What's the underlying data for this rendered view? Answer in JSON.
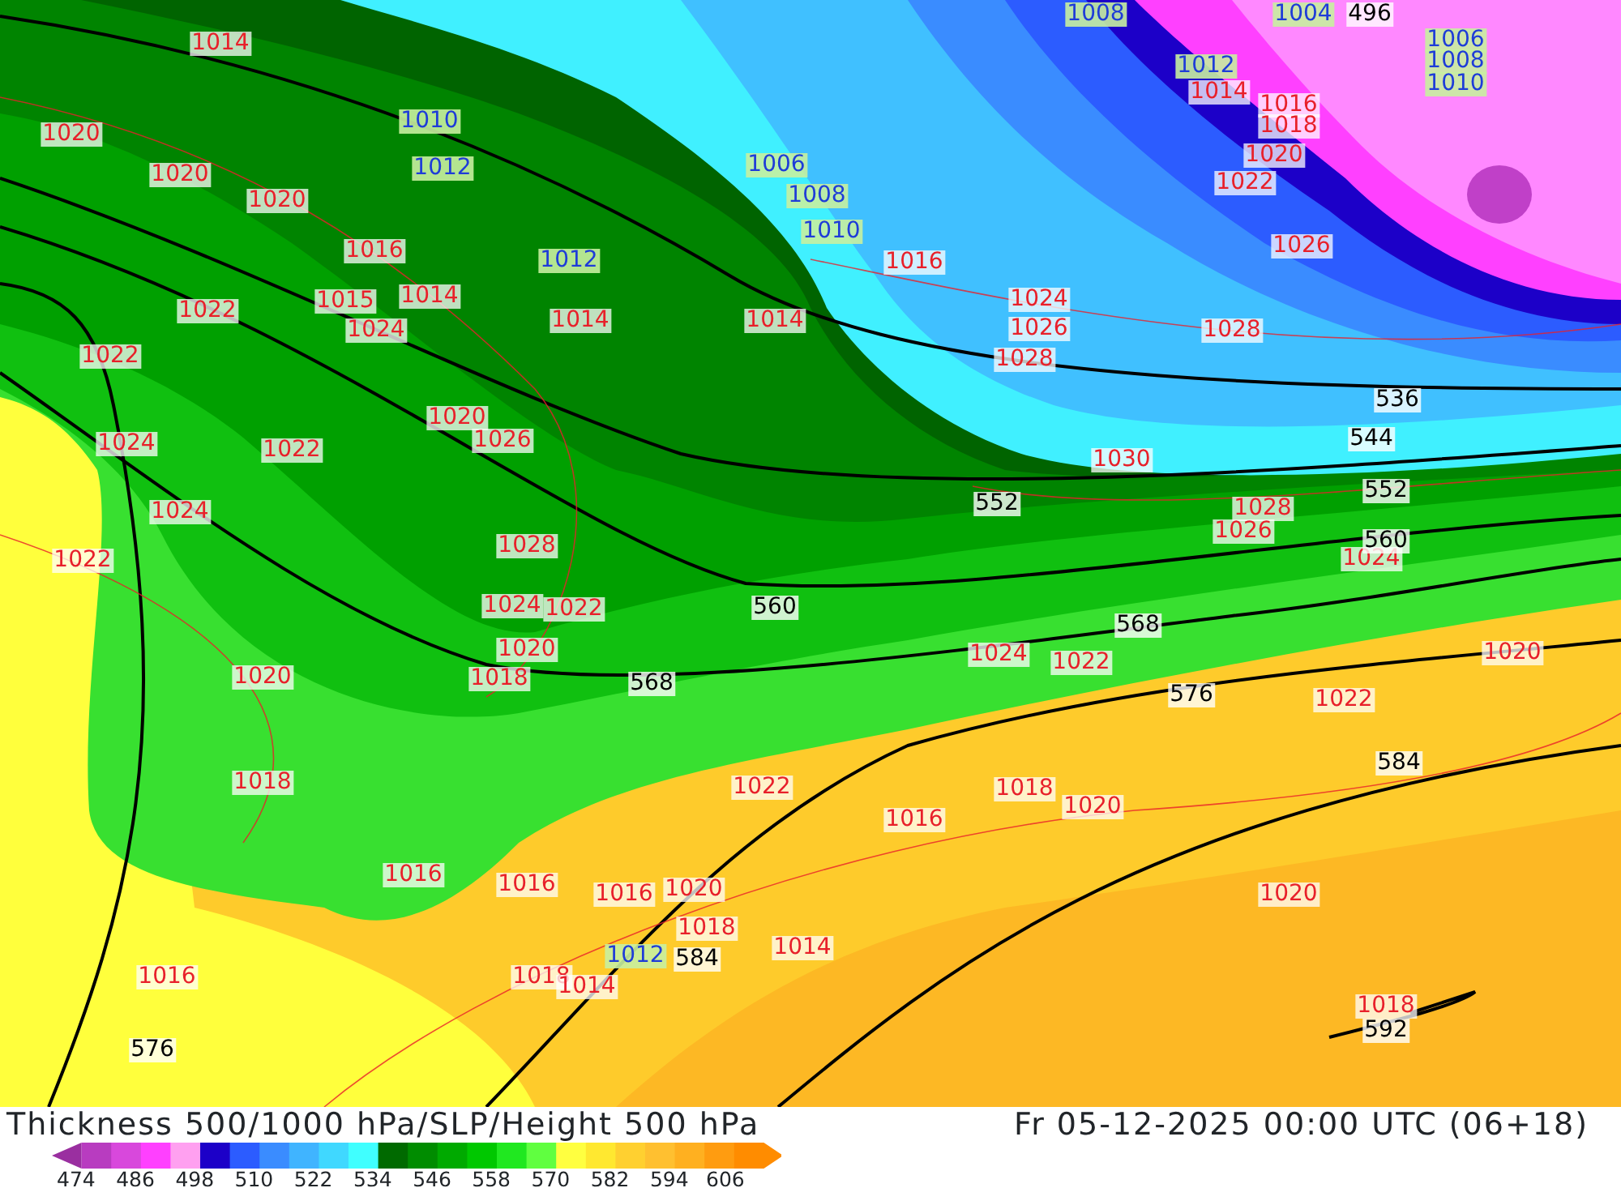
{
  "map": {
    "pressure_labels": [
      "1008",
      "1004",
      "1014",
      "1006",
      "1012",
      "1008",
      "1014",
      "1010",
      "1016",
      "1020",
      "1010",
      "1018",
      "1020",
      "1020",
      "1012",
      "1006",
      "1022",
      "1020",
      "1008",
      "1010",
      "1016",
      "1012",
      "1016",
      "1026",
      "1022",
      "1015",
      "1014",
      "1024",
      "1024",
      "1014",
      "1014",
      "1026",
      "1028",
      "1022",
      "1028",
      "1020",
      "1024",
      "1022",
      "1026",
      "1030",
      "1024",
      "1028",
      "1028",
      "1026",
      "1022",
      "1024",
      "1024",
      "1022",
      "1020",
      "1024",
      "1022",
      "1020",
      "1020",
      "1018",
      "1022",
      "1018",
      "1022",
      "1018",
      "1016",
      "1020",
      "1016",
      "1016",
      "1016",
      "1020",
      "1020",
      "1018",
      "1012",
      "1014",
      "1016",
      "1018",
      "1014",
      "1018"
    ],
    "height_labels": [
      "496",
      "536",
      "544",
      "552",
      "552",
      "560",
      "560",
      "568",
      "568",
      "576",
      "584",
      "584",
      "576",
      "592"
    ]
  },
  "footer": {
    "title": "Thickness 500/1000 hPa/SLP/Height 500 hPa",
    "valid_time": "Fr 05-12-2025 00:00 UTC (06+18)",
    "legend": {
      "segments": [
        {
          "color": "#9a2fa0"
        },
        {
          "color": "#b83cc0"
        },
        {
          "color": "#d848dc"
        },
        {
          "color": "#ff40ff"
        },
        {
          "color": "#ffa0f0"
        },
        {
          "color": "#1c00c8"
        },
        {
          "color": "#2c5cff"
        },
        {
          "color": "#3a8cff"
        },
        {
          "color": "#40b4ff"
        },
        {
          "color": "#40d8ff"
        },
        {
          "color": "#40ffff"
        },
        {
          "color": "#006a00"
        },
        {
          "color": "#008c00"
        },
        {
          "color": "#00aa00"
        },
        {
          "color": "#00c800"
        },
        {
          "color": "#20e820"
        },
        {
          "color": "#60ff40"
        },
        {
          "color": "#ffff40"
        },
        {
          "color": "#ffe830"
        },
        {
          "color": "#ffd030"
        },
        {
          "color": "#ffc030"
        },
        {
          "color": "#ffb020"
        },
        {
          "color": "#ff9c10"
        },
        {
          "color": "#ff8c00"
        }
      ],
      "ticks": [
        "474",
        "486",
        "498",
        "510",
        "522",
        "534",
        "546",
        "558",
        "570",
        "582",
        "594",
        "606"
      ]
    }
  }
}
